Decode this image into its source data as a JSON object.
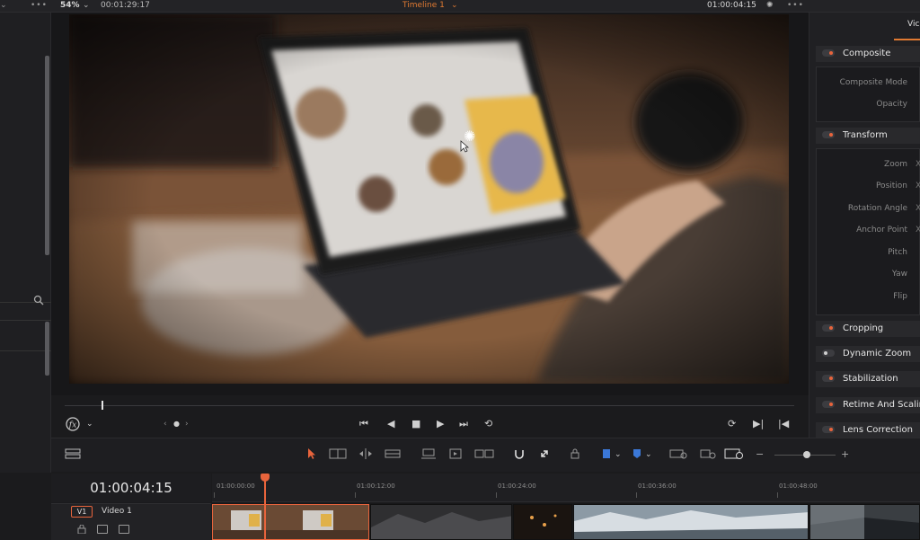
{
  "topbar": {
    "zoom": "54%",
    "timecode_left": "00:01:29:17",
    "timeline_title": "Timeline 1",
    "timecode_right": "01:00:04:15",
    "more": "•••"
  },
  "inspector": {
    "tab_label": "Vic",
    "sections": {
      "composite": "Composite",
      "transform": "Transform",
      "cropping": "Cropping",
      "dynamic_zoom": "Dynamic Zoom",
      "stabilization": "Stabilization",
      "retime": "Retime And Scaling",
      "lens": "Lens Correction"
    },
    "composite_params": [
      "Composite Mode",
      "Opacity"
    ],
    "transform_params": [
      "Zoom",
      "Position",
      "Rotation Angle",
      "Anchor Point",
      "Pitch",
      "Yaw",
      "Flip"
    ],
    "param_marks": [
      "X",
      "X",
      "X",
      "X"
    ]
  },
  "timeline": {
    "current_timecode": "01:00:04:15",
    "ruler_labels": [
      "01:00:00:00",
      "01:00:12:00",
      "01:00:24:00",
      "01:00:36:00",
      "01:00:48:00"
    ],
    "track": {
      "badge": "V1",
      "name": "Video 1"
    }
  },
  "colors": {
    "accent": "#e8643c",
    "title": "#e07a32"
  }
}
